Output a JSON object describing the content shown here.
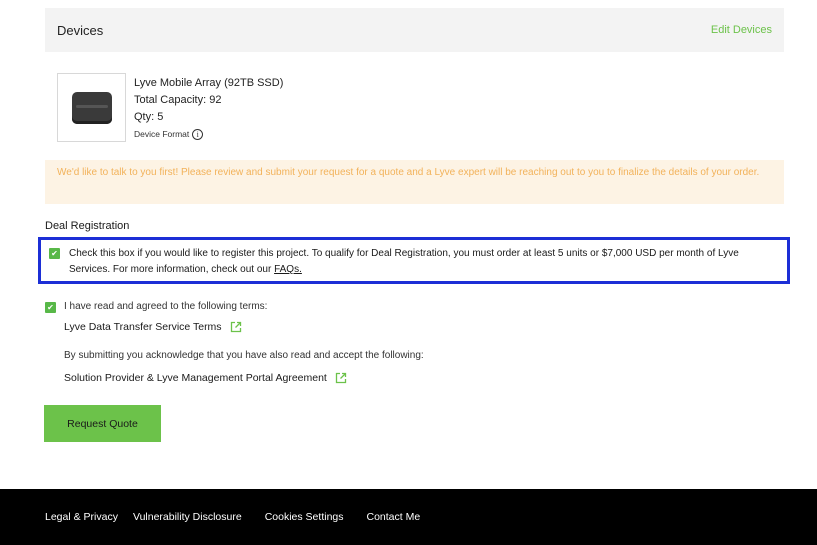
{
  "devices": {
    "title": "Devices",
    "edit_label": "Edit Devices",
    "item": {
      "name": "Lyve Mobile Array (92TB SSD)",
      "capacity": "Total Capacity: 92",
      "qty": "Qty: 5",
      "format_label": "Device Format",
      "thumbnail_icon": "storage-array-icon"
    }
  },
  "notice": {
    "text": "We'd like to talk to you first! Please review and submit your request for a quote and a Lyve expert will be reaching out to you to finalize the details of your order."
  },
  "deal_registration": {
    "label": "Deal Registration",
    "checked": true,
    "text": "Check this box if you would like to register this project. To qualify for Deal Registration, you must order at least 5 units or $7,000 USD per month of Lyve Services. For more information, check out our ",
    "faq_link": "FAQs."
  },
  "terms": {
    "checked": true,
    "agree_text": "I have read and agreed to the following terms:",
    "service_terms_link": "Lyve Data Transfer Service Terms",
    "ack_text": "By submitting you acknowledge that you have also read and accept the following:",
    "portal_agreement_link": "Solution Provider & Lyve Management Portal Agreement"
  },
  "request_button": "Request Quote",
  "footer": {
    "links": [
      "Legal & Privacy",
      "Vulnerability Disclosure",
      "Cookies Settings",
      "Contact Me"
    ]
  },
  "colors": {
    "accent_green": "#6cc24a",
    "highlight_border": "#1c2fd6",
    "notice_bg": "#fdf3e4",
    "notice_text": "#f2b25a",
    "footer_bg": "#000000"
  }
}
